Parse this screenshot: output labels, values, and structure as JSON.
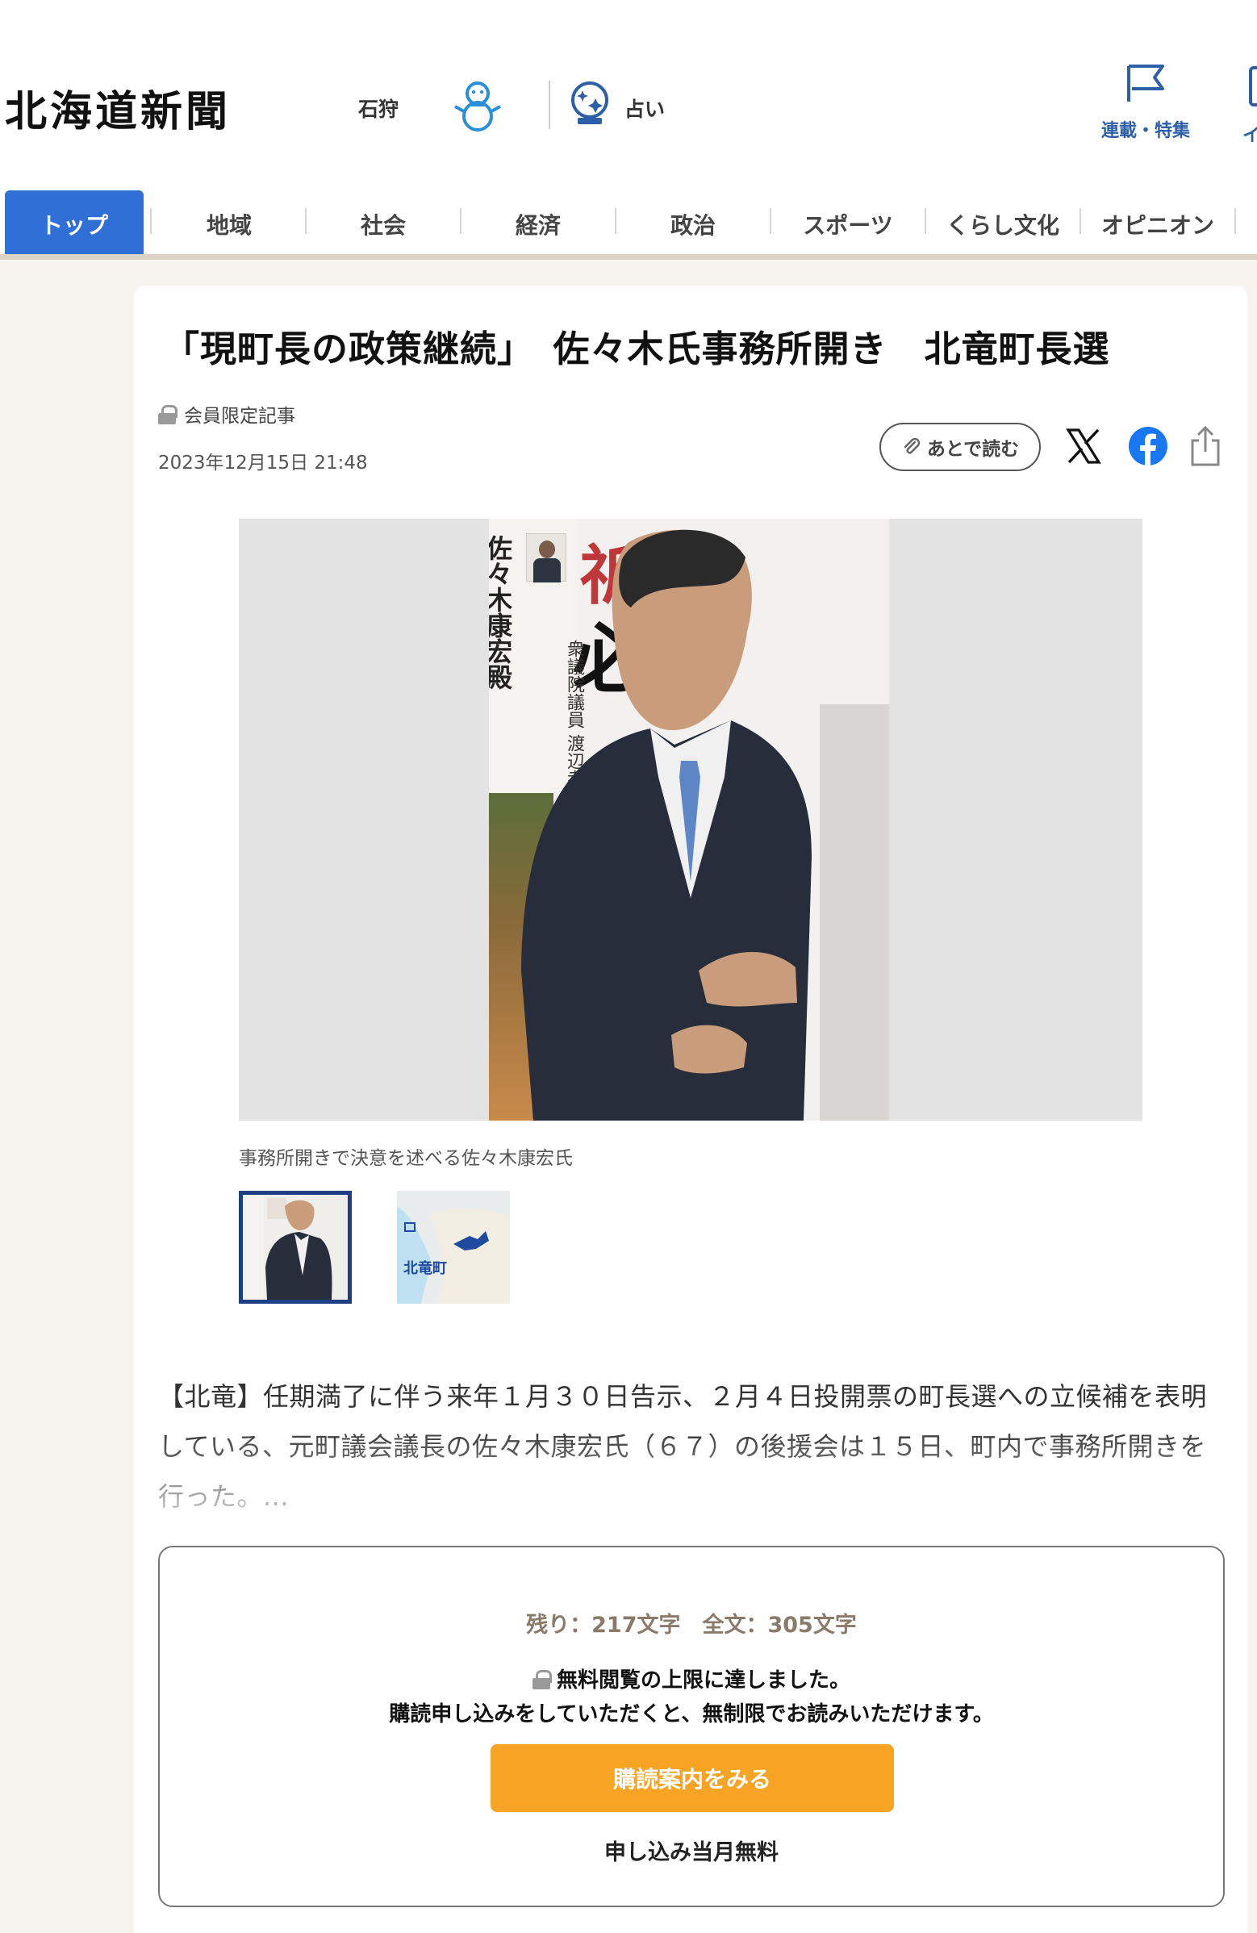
{
  "header": {
    "logo": "北海道新聞",
    "region": "石狩",
    "weather_icon": "snowman-icon",
    "fortune_label": "占い",
    "fortune_icon": "crystal-ball-icon",
    "series_label": "連載・特集",
    "series_icon": "flag-icon",
    "cut_label": "イ"
  },
  "nav": {
    "tabs": [
      {
        "label": "トップ",
        "active": true
      },
      {
        "label": "地域"
      },
      {
        "label": "社会"
      },
      {
        "label": "経済"
      },
      {
        "label": "政治"
      },
      {
        "label": "スポーツ"
      },
      {
        "label": "くらし文化"
      },
      {
        "label": "オピニオン"
      }
    ],
    "active_color": "#2f6fd6"
  },
  "article": {
    "title": "「現町長の政策継続」　佐々木氏事務所開き　北竜町長選",
    "member_label": "会員限定記事",
    "date": "2023年12月15日 21:48",
    "read_later": "あとで読む",
    "photo_caption": "事務所開きで決意を述べる佐々木康宏氏",
    "photo_banner_text": "佐々木康宏殿",
    "photo_poster_char1": "祈",
    "photo_poster_char2": "必",
    "photo_poster_vertical": "衆議院議員 渡辺孝",
    "map_label": "北竜町",
    "body": "【北竜】任期満了に伴う来年１月３０日告示、２月４日投開票の町長選への立候補を表明している、元町議会議長の佐々木康宏氏（６７）の後援会は１５日、町内で事務所開きを行った。..."
  },
  "paywall": {
    "remaining": "残り：217文字　全文：305文字",
    "limit_text": "無料閲覧の上限に達しました。",
    "subscribe_note": "購読申し込みをしていただくと、無制限でお読みいただけます。",
    "button_label": "購読案内をみる",
    "free_note": "申し込み当月無料",
    "button_color": "#f7a323"
  }
}
